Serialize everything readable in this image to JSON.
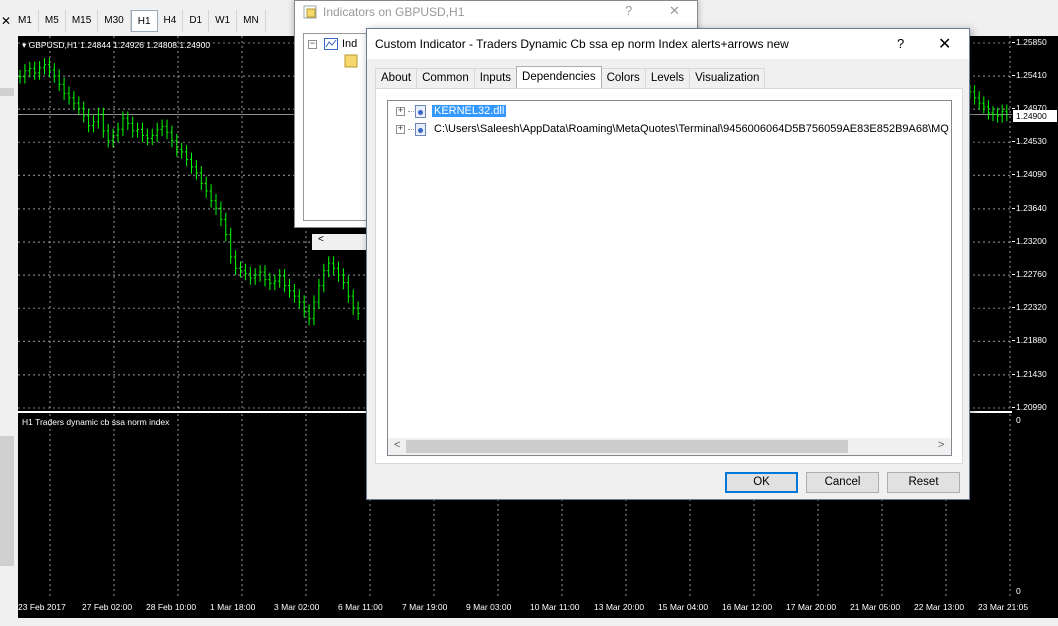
{
  "toolbar": {
    "close_glyph": "✕",
    "timeframes": [
      "M1",
      "M5",
      "M15",
      "M30",
      "H1",
      "H4",
      "D1",
      "W1",
      "MN"
    ],
    "active_timeframe": "H1"
  },
  "chart": {
    "header": "GBPUSD,H1  1.24844 1.24926 1.24808 1.24900",
    "current_price": "1.24900",
    "price_labels": [
      "1.25850",
      "1.25410",
      "1.24970",
      "1.24530",
      "1.24090",
      "1.23640",
      "1.23200",
      "1.22760",
      "1.22320",
      "1.21880",
      "1.21430",
      "1.20990"
    ],
    "sub_header": "H1  Traders dynamic cb ssa norm index",
    "sub_zero": "0",
    "sub_zero_bottom": "0",
    "time_labels": [
      "23 Feb 2017",
      "27 Feb 02:00",
      "28 Feb 10:00",
      "1 Mar 18:00",
      "3 Mar 02:00",
      "6 Mar 11:00",
      "7 Mar 19:00",
      "9 Mar 03:00",
      "10 Mar 11:00",
      "13 Mar 20:00",
      "15 Mar 04:00",
      "16 Mar 12:00",
      "17 Mar 20:00",
      "21 Mar 05:00",
      "22 Mar 13:00",
      "23 Mar 21:05"
    ],
    "candle_color": "#00ff00",
    "grid_color": "#ffffff",
    "series_close": [
      1.254,
      1.2548,
      1.2551,
      1.2545,
      1.2552,
      1.2556,
      1.2549,
      1.2541,
      1.253,
      1.2518,
      1.2512,
      1.2505,
      1.2498,
      1.2488,
      1.2475,
      1.248,
      1.249,
      1.2468,
      1.2455,
      1.2462,
      1.247,
      1.2485,
      1.2478,
      1.2468,
      1.247,
      1.2462,
      1.2458,
      1.2462,
      1.247,
      1.2474,
      1.2466,
      1.2455,
      1.2443,
      1.244,
      1.243,
      1.242,
      1.2412,
      1.2398,
      1.2388,
      1.2375,
      1.2365,
      1.235,
      1.233,
      1.23,
      1.2285,
      1.2282,
      1.2278,
      1.2272,
      1.2276,
      1.228,
      1.227,
      1.2265,
      1.2268,
      1.2275,
      1.2262,
      1.2255,
      1.2248,
      1.224,
      1.2228,
      1.2218,
      1.224,
      1.2262,
      1.2282,
      1.2292,
      1.2285,
      1.2276,
      1.2266,
      1.2248,
      1.2232,
      1.2225
    ],
    "series_close_right": [
      1.252,
      1.2512,
      1.2505,
      1.25,
      1.2492,
      1.249,
      1.2488,
      1.2494,
      1.249
    ]
  },
  "indicators_window": {
    "title": "Indicators on GBPUSD,H1",
    "help_glyph": "?",
    "close_glyph": "✕",
    "tree_item": "Ind",
    "scroll_left_glyph": "<"
  },
  "dialog": {
    "title": "Custom Indicator - Traders Dynamic Cb ssa ep norm Index alerts+arrows new",
    "help_glyph": "?",
    "close_glyph": "✕",
    "tabs": [
      "About",
      "Common",
      "Inputs",
      "Dependencies",
      "Colors",
      "Levels",
      "Visualization"
    ],
    "active_tab": "Dependencies",
    "dependencies": [
      {
        "expander": "+",
        "label": "KERNEL32.dll",
        "selected": true
      },
      {
        "expander": "+",
        "label": "C:\\Users\\Saleesh\\AppData\\Roaming\\MetaQuotes\\Terminal\\9456006064D5B756059AE83E852B9A68\\MQ",
        "selected": false
      }
    ],
    "scroll_left_glyph": "<",
    "scroll_right_glyph": ">",
    "buttons": {
      "ok": "OK",
      "cancel": "Cancel",
      "reset": "Reset"
    }
  }
}
